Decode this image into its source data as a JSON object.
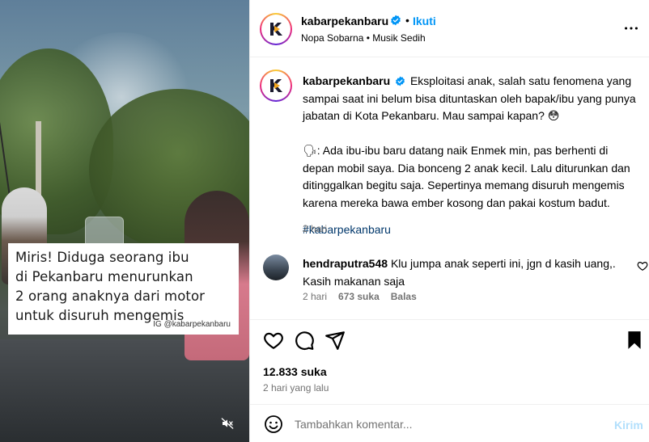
{
  "media": {
    "caption_lines": [
      "Miris! Diduga seorang ibu",
      "di Pekanbaru menurunkan",
      "2 orang anaknya dari motor",
      "untuk disuruh mengemis"
    ],
    "credit": "IG @kabarpekanbaru",
    "mute_icon": "speaker-muted-icon"
  },
  "header": {
    "username": "kabarpekanbaru",
    "separator": "•",
    "follow_label": "Ikuti",
    "subtitle": "Nopa Sobarna • Musik Sedih",
    "more_icon": "more-horizontal-icon"
  },
  "caption": {
    "username": "kabarpekanbaru",
    "paragraph1": "Eksploitasi anak, salah satu fenomena yang sampai saat ini belum bisa dituntaskan oleh bapak/ibu yang punya jabatan di Kota Pekanbaru. Mau sampai kapan? 😳",
    "paragraph2": "🗣: Ada ibu-ibu baru datang naik Enmek min, pas berhenti di depan mobil saya. Dia bonceng 2 anak kecil. Lalu diturunkan dan ditinggalkan begitu saja. Sepertinya memang disuruh mengemis karena mereka bawa ember kosong dan pakai kostum badut.",
    "hashtag": "#kabarpekanbaru",
    "time": "2 hari"
  },
  "comment": {
    "username": "hendraputra548",
    "text": "Klu jumpa anak seperti ini, jgn d kasih uang,. Kasih makanan saja",
    "time": "2 hari",
    "likes": "673 suka",
    "reply_label": "Balas"
  },
  "actions": {
    "likes_count": "12.833 suka",
    "posted_time": "2 hari yang lalu"
  },
  "composer": {
    "placeholder": "Tambahkan komentar...",
    "send_label": "Kirim"
  },
  "colors": {
    "link_blue": "#0095f6",
    "hashtag_blue": "#00376b",
    "muted_gray": "#737373",
    "send_disabled": "#b2dffc",
    "verified_blue": "#0095f6"
  }
}
